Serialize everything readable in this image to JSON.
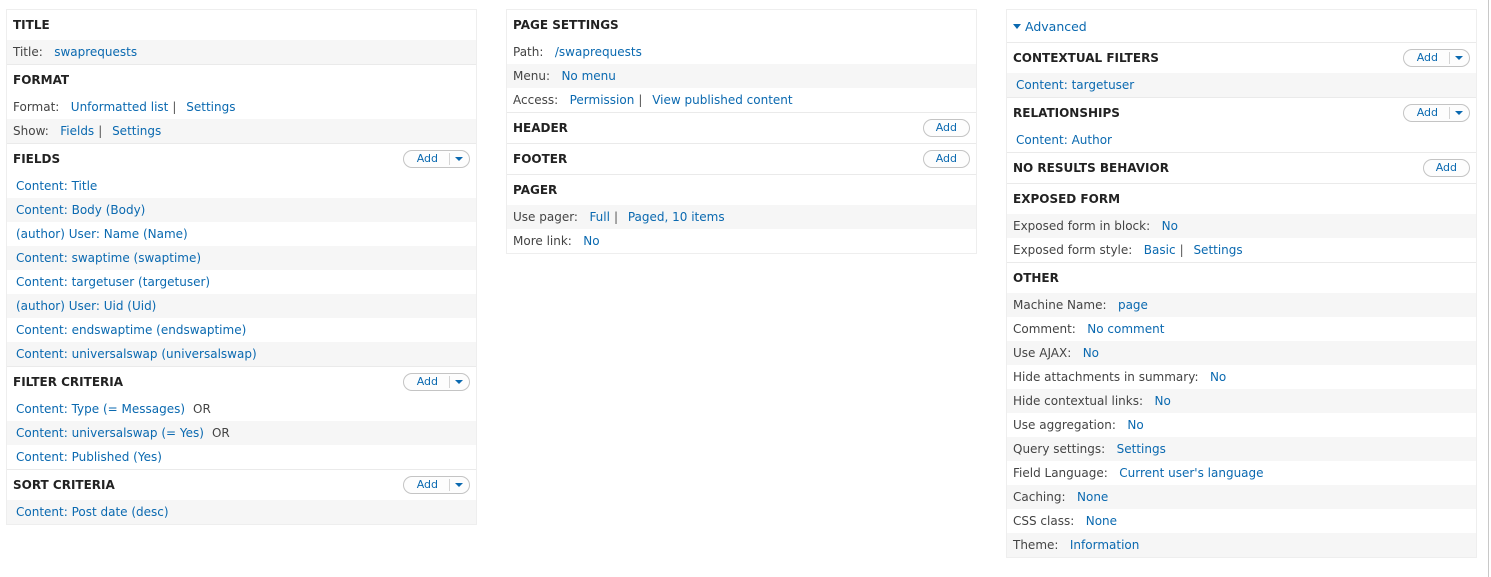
{
  "colors": {
    "link": "#0a69b0",
    "alt_row": "#f6f6f6",
    "border": "#eeeeee"
  },
  "column1": {
    "title": {
      "heading": "TITLE",
      "rows": [
        {
          "label": "Title:",
          "value": "swaprequests"
        }
      ]
    },
    "format": {
      "heading": "FORMAT",
      "format_label": "Format:",
      "format_value": "Unformatted list",
      "format_settings": "Settings",
      "show_label": "Show:",
      "show_value": "Fields",
      "show_settings": "Settings"
    },
    "fields": {
      "heading": "FIELDS",
      "add_label": "Add",
      "items": [
        "Content: Title",
        "Content: Body (Body)",
        "(author) User: Name (Name)",
        "Content: swaptime (swaptime)",
        "Content: targetuser (targetuser)",
        "(author) User: Uid (Uid)",
        "Content: endswaptime (endswaptime)",
        "Content: universalswap (universalswap)"
      ]
    },
    "filter_criteria": {
      "heading": "FILTER CRITERIA",
      "add_label": "Add",
      "items": [
        {
          "text": "Content: Type (= Messages)",
          "op": "OR"
        },
        {
          "text": "Content: universalswap (= Yes)",
          "op": "OR"
        },
        {
          "text": "Content: Published (Yes)",
          "op": ""
        }
      ]
    },
    "sort_criteria": {
      "heading": "SORT CRITERIA",
      "add_label": "Add",
      "items": [
        "Content: Post date (desc)"
      ]
    }
  },
  "column2": {
    "page_settings": {
      "heading": "PAGE SETTINGS",
      "path_label": "Path:",
      "path_value": "/swaprequests",
      "menu_label": "Menu:",
      "menu_value": "No menu",
      "access_label": "Access:",
      "access_value": "Permission",
      "access_detail": "View published content"
    },
    "header": {
      "heading": "HEADER",
      "add_label": "Add"
    },
    "footer": {
      "heading": "FOOTER",
      "add_label": "Add"
    },
    "pager": {
      "heading": "PAGER",
      "use_pager_label": "Use pager:",
      "use_pager_value": "Full",
      "use_pager_detail": "Paged, 10 items",
      "more_link_label": "More link:",
      "more_link_value": "No"
    }
  },
  "column3": {
    "advanced_label": "Advanced",
    "contextual_filters": {
      "heading": "CONTEXTUAL FILTERS",
      "add_label": "Add",
      "items": [
        "Content: targetuser"
      ]
    },
    "relationships": {
      "heading": "RELATIONSHIPS",
      "add_label": "Add",
      "items": [
        "Content: Author"
      ]
    },
    "no_results": {
      "heading": "NO RESULTS BEHAVIOR",
      "add_label": "Add"
    },
    "exposed_form": {
      "heading": "EXPOSED FORM",
      "in_block_label": "Exposed form in block:",
      "in_block_value": "No",
      "style_label": "Exposed form style:",
      "style_value": "Basic",
      "style_settings": "Settings"
    },
    "other": {
      "heading": "OTHER",
      "rows": [
        {
          "label": "Machine Name:",
          "value": "page"
        },
        {
          "label": "Comment:",
          "value": "No comment"
        },
        {
          "label": "Use AJAX:",
          "value": "No"
        },
        {
          "label": "Hide attachments in summary:",
          "value": "No"
        },
        {
          "label": "Hide contextual links:",
          "value": "No"
        },
        {
          "label": "Use aggregation:",
          "value": "No"
        },
        {
          "label": "Query settings:",
          "value": "Settings"
        },
        {
          "label": "Field Language:",
          "value": "Current user's language"
        },
        {
          "label": "Caching:",
          "value": "None"
        },
        {
          "label": "CSS class:",
          "value": "None"
        },
        {
          "label": "Theme:",
          "value": "Information"
        }
      ]
    }
  }
}
